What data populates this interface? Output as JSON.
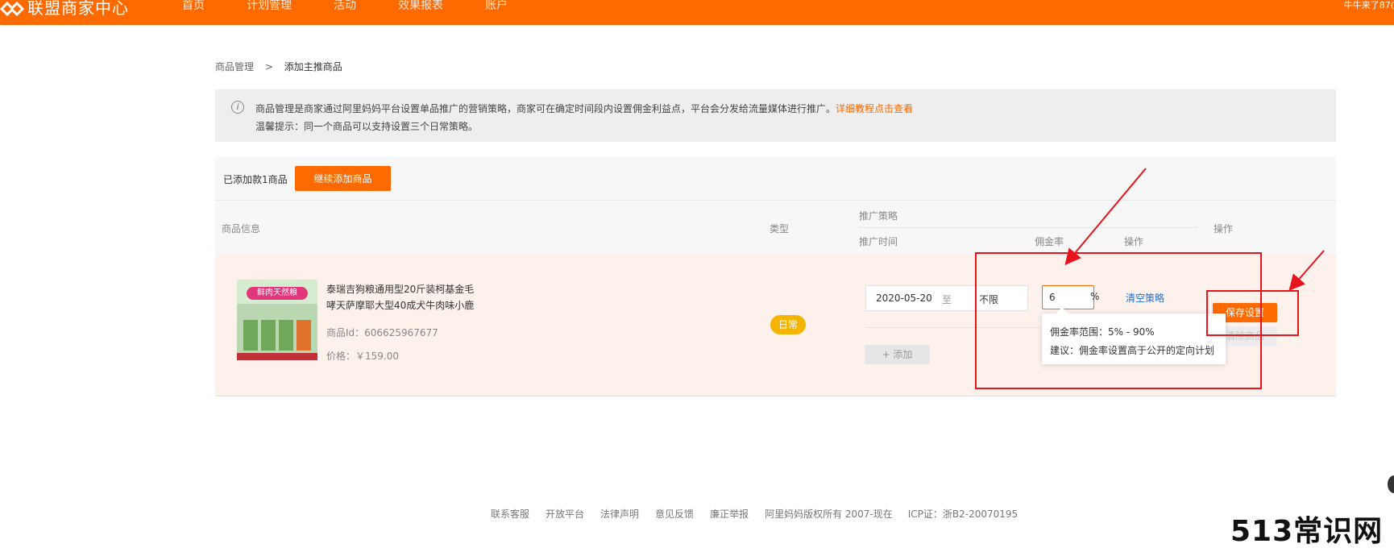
{
  "colors": {
    "accent": "#ff6a00",
    "link": "#1a73d9",
    "annotation": "#e8141c",
    "badge": "#f5b400"
  },
  "header": {
    "logo_text": "联盟商家中心",
    "nav": [
      "首页",
      "计划管理",
      "活动",
      "效果报表",
      "账户"
    ],
    "user": "牛牛来了87("
  },
  "breadcrumb": {
    "parent": "商品管理",
    "separator": ">",
    "current": "添加主推商品"
  },
  "notice": {
    "line1": "商品管理是商家通过阿里妈妈平台设置单品推广的营销策略，商家可在确定时间段内设置佣金利益点，平台会分发给流量媒体进行推广。",
    "link": "详细教程点击查看",
    "line2": "温馨提示：同一个商品可以支持设置三个日常策略。"
  },
  "toolbar": {
    "added_count": "已添加款1商品",
    "continue_button": "继续添加商品"
  },
  "table": {
    "headers": {
      "product_info": "商品信息",
      "type": "类型",
      "strategy": "推广策略",
      "time": "推广时间",
      "rate": "佣金率",
      "strategy_action": "操作",
      "action": "操作"
    },
    "rows": [
      {
        "image_label": "鲜肉天然粮",
        "name": "泰瑞吉狗粮通用型20斤装柯基金毛哮天萨摩耶大型40成犬牛肉味小鹿",
        "product_id": "商品Id：606625967677",
        "price": "价格：￥159.00",
        "type_badge": "日常",
        "date_start": "2020-05-20",
        "date_to": "至",
        "date_end": "不限",
        "rate_value": "6",
        "rate_unit": "%",
        "clear_strategy": "清空策略",
        "add_button": "+ 添加",
        "save_button": "保存设置",
        "remove_button": "清除商品",
        "tooltip_range": "佣金率范围：5% - 90%",
        "tooltip_hint": "建议：佣金率设置高于公开的定向计划"
      }
    ]
  },
  "footer": {
    "links": [
      "联系客服",
      "开放平台",
      "法律声明",
      "意见反馈",
      "廉正举报"
    ],
    "copyright": "阿里妈妈版权所有 2007-现在",
    "icp": "ICP证：浙B2-20070195"
  },
  "watermark": "513常识网"
}
